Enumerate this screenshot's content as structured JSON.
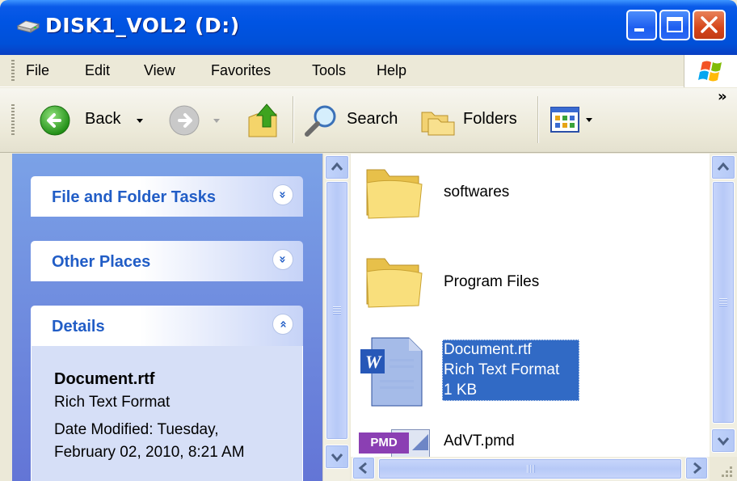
{
  "window": {
    "title": "DISK1_VOL2 (D:)"
  },
  "menu": [
    "File",
    "Edit",
    "View",
    "Favorites",
    "Tools",
    "Help"
  ],
  "toolbar": {
    "back_label": "Back",
    "search_label": "Search",
    "folders_label": "Folders",
    "overflow": "»"
  },
  "taskpane": {
    "file_folder_tasks": "File and Folder Tasks",
    "other_places": "Other Places",
    "details": "Details",
    "expand_glyph": "»",
    "details_name": "Document.rtf",
    "details_type": "Rich Text Format",
    "details_date_line1": "Date Modified: Tuesday,",
    "details_date_line2": "February 02, 2010, 8:21 AM"
  },
  "files": [
    {
      "name": "softwares",
      "type": "folder"
    },
    {
      "name": "Program Files",
      "type": "folder"
    },
    {
      "name": "Document.rtf",
      "subtitle": "Rich Text Format",
      "size": "1 KB",
      "type": "rtf",
      "selected": true
    },
    {
      "name": "AdVT.pmd",
      "badge": "PMD",
      "type": "pmd"
    }
  ],
  "colors": {
    "titlebar": "#0054e3",
    "selection": "#316ac5",
    "panel_title": "#215dc6"
  }
}
